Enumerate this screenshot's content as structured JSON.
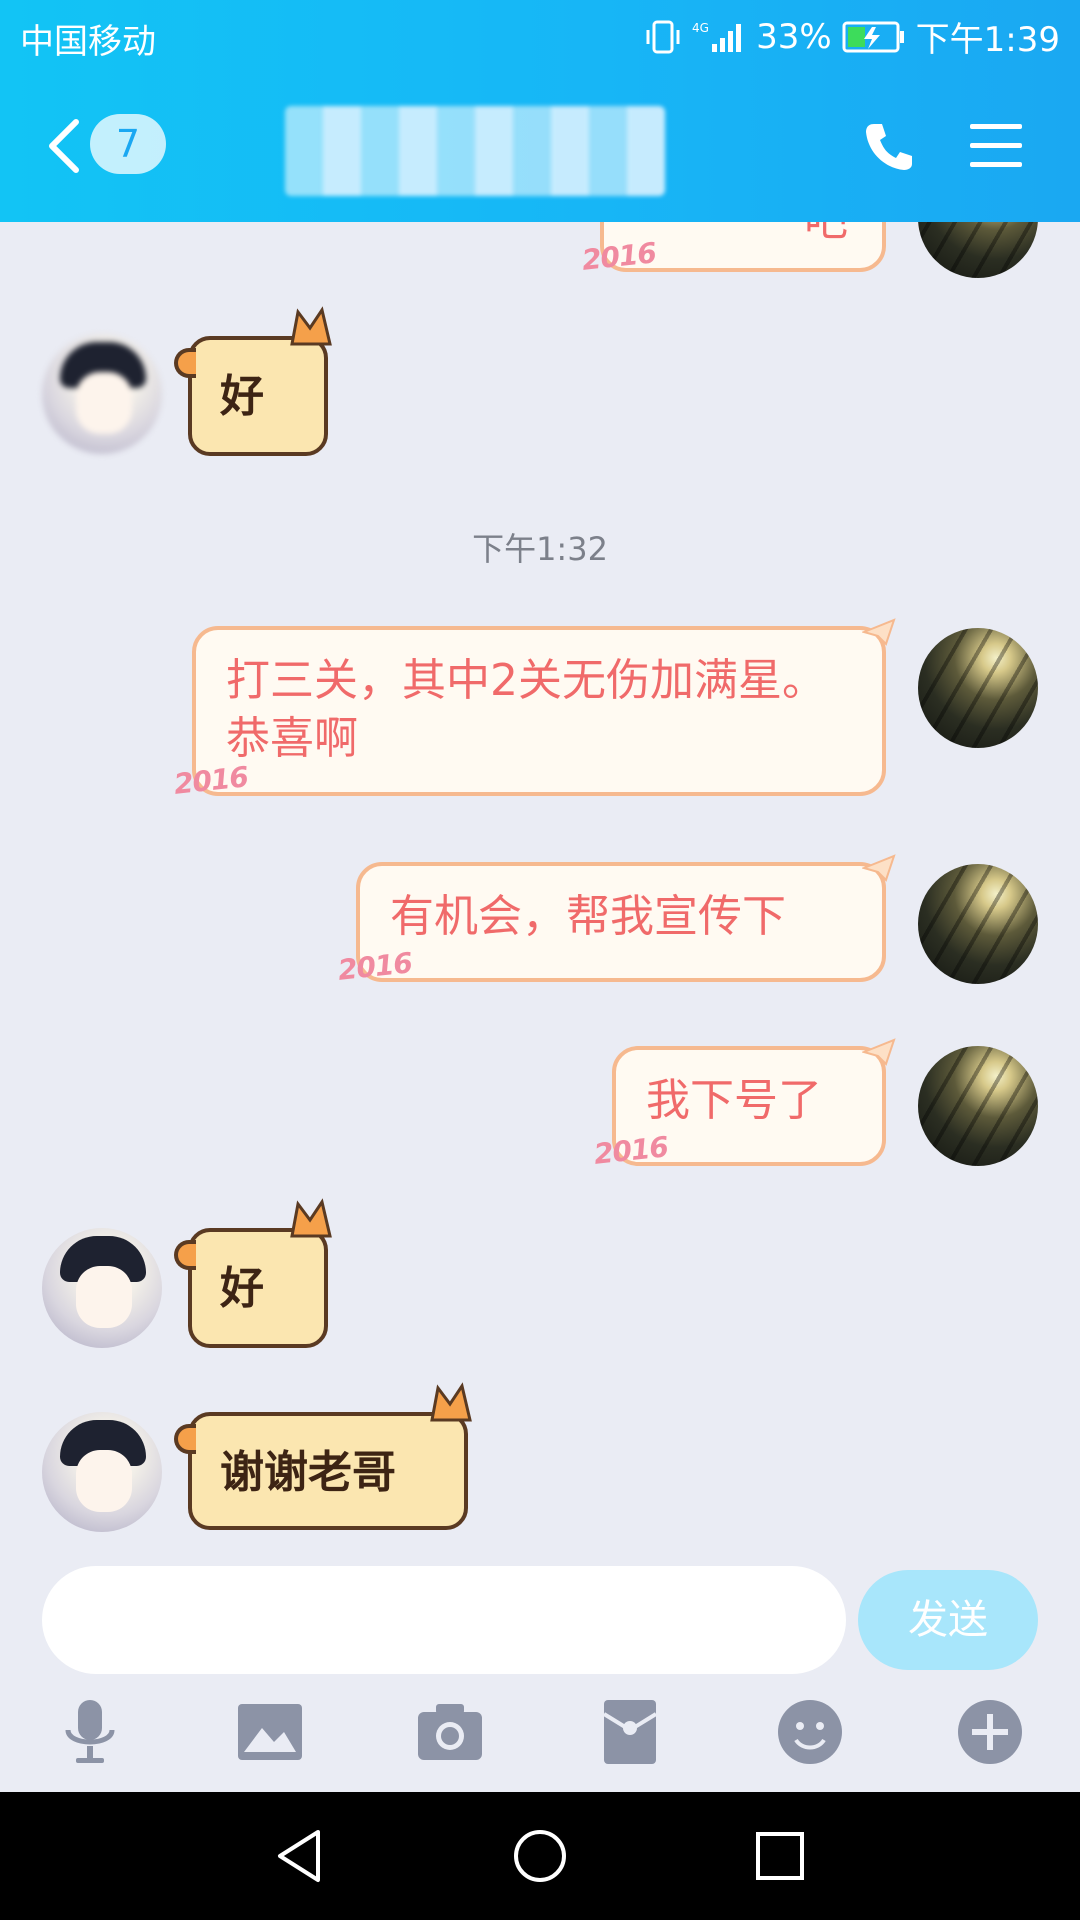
{
  "status_bar": {
    "carrier": "中国移动",
    "network": "4G",
    "battery": "33%",
    "time": "下午1:39"
  },
  "header": {
    "unread_count": "7",
    "contact_name": ""
  },
  "chat": {
    "time_separator": "下午1:32",
    "messages": [
      {
        "from": "them",
        "text": "好"
      },
      {
        "from": "me",
        "text": "打三关，其中2关无伤加满星。恭喜啊"
      },
      {
        "from": "me",
        "text": "有机会，帮我宣传下"
      },
      {
        "from": "me",
        "text": "我下号了"
      },
      {
        "from": "them",
        "text": "好"
      },
      {
        "from": "them",
        "text": "谢谢老哥"
      }
    ],
    "bubble_decoration": "2016",
    "partial_top_text": "吧"
  },
  "input": {
    "value": "",
    "send_label": "发送"
  },
  "colors": {
    "header_gradient_start": "#12c4f5",
    "header_gradient_end": "#1aa8f2",
    "outgoing_text": "#f06a6a",
    "background": "#eaecf4",
    "send_button": "#a8e6fb"
  }
}
